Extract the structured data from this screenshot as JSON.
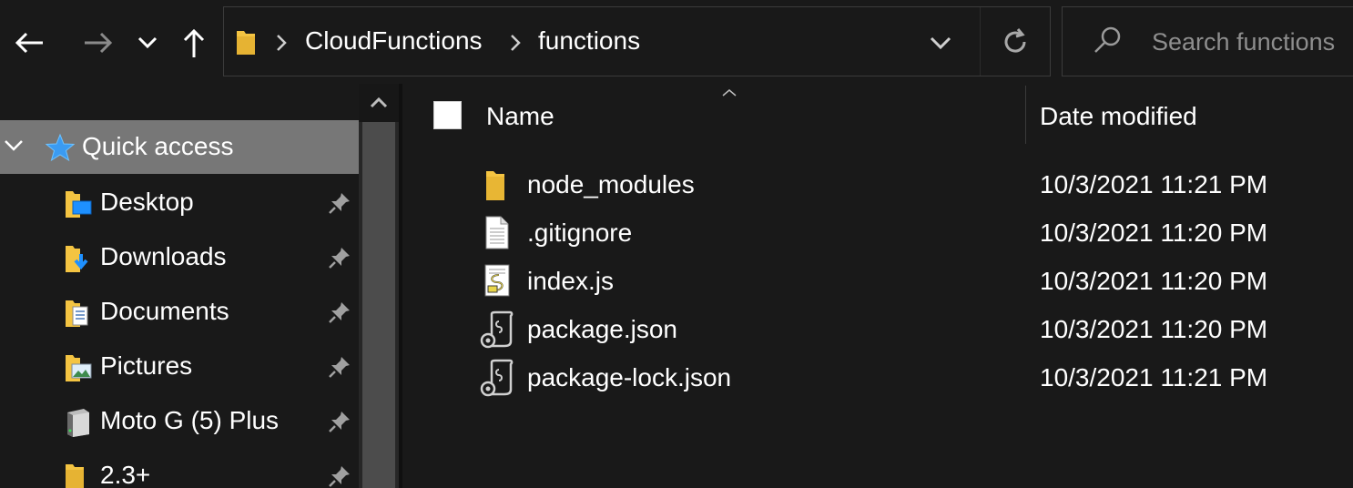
{
  "navigation": {
    "back": "back-arrow-icon",
    "forward": "forward-arrow-icon",
    "recent": "chevron-down-icon",
    "up": "up-arrow-icon"
  },
  "address": {
    "crumbs": [
      "CloudFunctions",
      "functions"
    ]
  },
  "search": {
    "placeholder": "Search functions"
  },
  "sidebar": {
    "quick_access": "Quick access",
    "items": [
      {
        "label": "Desktop",
        "icon": "desktop-folder-icon",
        "pinned": true
      },
      {
        "label": "Downloads",
        "icon": "downloads-folder-icon",
        "pinned": true
      },
      {
        "label": "Documents",
        "icon": "documents-folder-icon",
        "pinned": true
      },
      {
        "label": "Pictures",
        "icon": "pictures-folder-icon",
        "pinned": true
      },
      {
        "label": "Moto G (5) Plus",
        "icon": "device-icon",
        "pinned": true
      },
      {
        "label": "2.3+",
        "icon": "folder-icon",
        "pinned": true
      }
    ]
  },
  "columns": {
    "name": "Name",
    "date": "Date modified"
  },
  "files": [
    {
      "name": "node_modules",
      "date": "10/3/2021 11:21 PM",
      "icon": "folder-icon"
    },
    {
      "name": ".gitignore",
      "date": "10/3/2021 11:20 PM",
      "icon": "text-file-icon"
    },
    {
      "name": "index.js",
      "date": "10/3/2021 11:20 PM",
      "icon": "script-file-icon"
    },
    {
      "name": "package.json",
      "date": "10/3/2021 11:20 PM",
      "icon": "json-file-icon"
    },
    {
      "name": "package-lock.json",
      "date": "10/3/2021 11:21 PM",
      "icon": "json-file-icon"
    }
  ],
  "colors": {
    "background": "#191919",
    "selected": "#777777",
    "folder": "#f4c442",
    "accent_blue": "#1e90ff"
  }
}
